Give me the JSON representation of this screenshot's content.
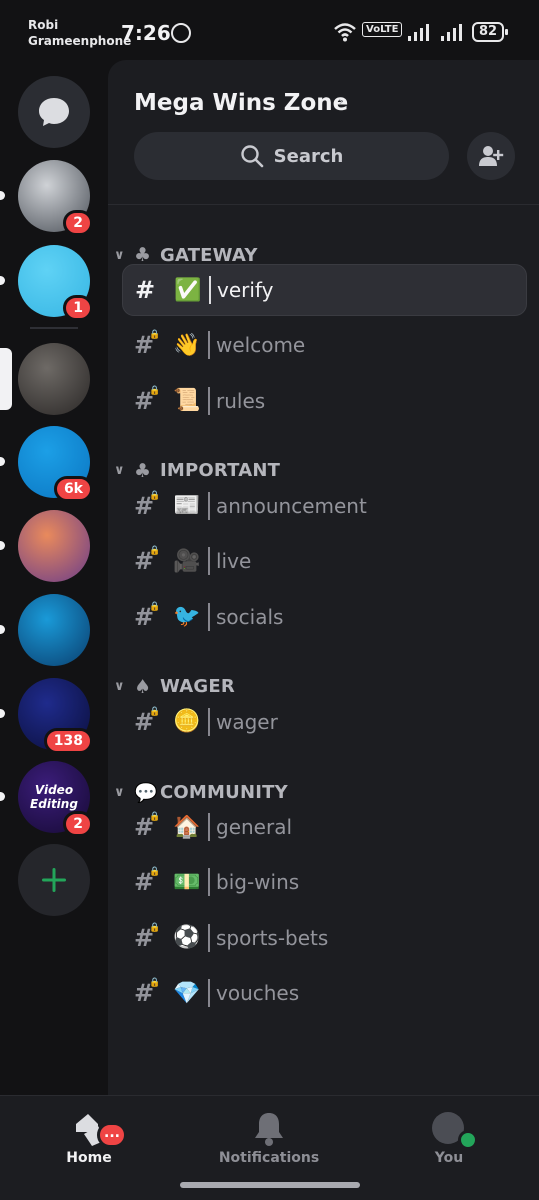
{
  "status_bar": {
    "carrier_line1": "Robi",
    "carrier_line2": "Grameenphone",
    "time": "7:26",
    "network": "VoLTE",
    "battery": "82"
  },
  "servers": [
    {
      "name": "server-1",
      "badge": "2",
      "colors": [
        "#cfd2d6",
        "#4b5058"
      ]
    },
    {
      "name": "server-2",
      "badge": "1",
      "colors": [
        "#5fd2f5",
        "#36b5e3"
      ]
    },
    {
      "name": "server-3",
      "badge": "",
      "selected": true,
      "colors": [
        "#6e6a66",
        "#2a2726"
      ]
    },
    {
      "name": "server-4",
      "badge": "6k",
      "colors": [
        "#1c9fe6",
        "#0b76c2"
      ]
    },
    {
      "name": "server-5",
      "badge": "",
      "colors": [
        "#e98a5c",
        "#6a3c8a"
      ]
    },
    {
      "name": "server-6",
      "badge": "",
      "colors": [
        "#1a9ad8",
        "#0a3e6e"
      ]
    },
    {
      "name": "server-7",
      "badge": "138",
      "colors": [
        "#1f2b8c",
        "#0b0f3c"
      ]
    },
    {
      "name": "server-8",
      "badge": "2",
      "logo_text": "Video Editing",
      "colors": [
        "#3b1d7a",
        "#160a34"
      ]
    }
  ],
  "header": {
    "server_name": "Mega Wins Zone",
    "search_label": "Search"
  },
  "categories": [
    {
      "name": "GATEWAY",
      "icon": "♣",
      "channels": [
        {
          "emoji": "✅",
          "name": "verify",
          "active": true,
          "locked": false
        },
        {
          "emoji": "👋",
          "name": "welcome",
          "locked": true
        },
        {
          "emoji": "📜",
          "name": "rules",
          "locked": true
        }
      ]
    },
    {
      "name": "IMPORTANT",
      "icon": "♣",
      "channels": [
        {
          "emoji": "📰",
          "name": "announcement",
          "locked": true
        },
        {
          "emoji": "🎥",
          "name": "live",
          "locked": true
        },
        {
          "emoji": "🐦",
          "name": "socials",
          "locked": true
        }
      ]
    },
    {
      "name": "WAGER",
      "icon": "♠",
      "channels": [
        {
          "emoji": "🪙",
          "name": "wager",
          "locked": true
        }
      ]
    },
    {
      "name": "COMMUNITY",
      "icon": "💬",
      "channels": [
        {
          "emoji": "🏠",
          "name": "general",
          "locked": true
        },
        {
          "emoji": "💵",
          "name": "big-wins",
          "locked": true
        },
        {
          "emoji": "⚽",
          "name": "sports-bets",
          "locked": true
        },
        {
          "emoji": "💎",
          "name": "vouches",
          "locked": true
        }
      ]
    }
  ],
  "bottom_nav": {
    "home_label": "Home",
    "notifications_label": "Notifications",
    "you_label": "You",
    "home_badge": "..."
  },
  "colors": {
    "background": "#121214",
    "panel": "#1c1d21",
    "badge": "#ef4444",
    "online": "#23a55a",
    "add_server": "#23a55a"
  }
}
